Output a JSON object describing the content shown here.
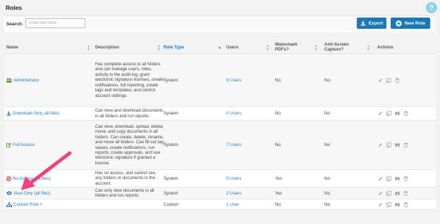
{
  "page": {
    "title": "Roles",
    "help_label": "?"
  },
  "toolbar": {
    "search_label": "Search:",
    "search_placeholder": "Enter text here",
    "export_label": "Export",
    "new_role_label": "New Role"
  },
  "table": {
    "columns": {
      "name": "Name",
      "description": "Description",
      "role_type": "Role Type",
      "users": "Users",
      "watermark": "Watermark PDFs?",
      "anti_screen": "Anti-Screen Capture?",
      "actions": "Actions"
    },
    "rows": [
      {
        "icon": "users-icon",
        "name": "Administrator",
        "description": "Has complete access to all folders and can manage users, roles, activity in the audit log, grant electronic signature licenses, create notifications, full reporting, create tags and templates, and control account settings.",
        "role_type": "System",
        "users": "9 Users",
        "watermark": "No",
        "anti_screen": "No"
      },
      {
        "icon": "download-icon",
        "name": "Download Only (all files)",
        "description": "Can view and download documents in all folders and run reports.",
        "role_type": "System",
        "users": "0 Users",
        "watermark": "No",
        "anti_screen": "No"
      },
      {
        "icon": "edit-icon",
        "name": "Full Access",
        "description": "Can view, download, upload, delete, move, and copy documents in all folders. Can create, delete, rename, and move all folders. Can fill out tag values, create notifications, run reports, create approvals, and use electronic signature if granted a license.",
        "role_type": "System",
        "users": "7 Users",
        "watermark": "No",
        "anti_screen": "No"
      },
      {
        "icon": "ban-icon",
        "name": "No Access (all files)",
        "description": "Has no access, and cannot see, any folders or documents in the account.",
        "role_type": "System",
        "users": "0 Users",
        "watermark": "Yes",
        "anti_screen": "No"
      },
      {
        "icon": "eye-icon",
        "name": "View Only (all files)",
        "description": "Can only view documents in all folders and run reports.",
        "role_type": "System",
        "users": "2 Users",
        "watermark": "Yes",
        "anti_screen": "No"
      },
      {
        "icon": "sitemap-icon",
        "name": "Custom Role +",
        "description": "",
        "role_type": "Custom",
        "users": "1 User",
        "watermark": "No",
        "anti_screen": "No"
      }
    ]
  },
  "colors": {
    "accent": "#1b78b5",
    "link": "#1f7bbf",
    "annotation_arrow": "#f0437c",
    "help_button": "#8fd3ea"
  }
}
